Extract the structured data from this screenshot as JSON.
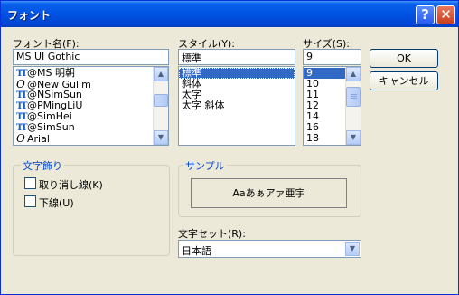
{
  "window": {
    "title": "フォント"
  },
  "font": {
    "label": "フォント名(F):",
    "value": "MS UI Gothic",
    "items": [
      {
        "glyph": "TT",
        "name": "@MS 明朝"
      },
      {
        "glyph": "O",
        "name": "@New Gulim"
      },
      {
        "glyph": "TT",
        "name": "@NSimSun"
      },
      {
        "glyph": "TT",
        "name": "@PMingLiU"
      },
      {
        "glyph": "TT",
        "name": "@SimHei"
      },
      {
        "glyph": "TT",
        "name": "@SimSun"
      },
      {
        "glyph": "O",
        "name": "Arial"
      }
    ]
  },
  "style": {
    "label": "スタイル(Y):",
    "value": "標準",
    "items": [
      "標準",
      "斜体",
      "太字",
      "太字 斜体"
    ],
    "selected": "標準"
  },
  "size": {
    "label": "サイズ(S):",
    "value": "9",
    "items": [
      "9",
      "10",
      "11",
      "12",
      "14",
      "16",
      "18"
    ],
    "selected": "9"
  },
  "buttons": {
    "ok": "OK",
    "cancel": "キャンセル"
  },
  "effects": {
    "title": "文字飾り",
    "strikeout": "取り消し線(K)",
    "underline": "下線(U)",
    "strikeout_checked": false,
    "underline_checked": false
  },
  "sample": {
    "title": "サンプル",
    "text": "Aaあぁアァ亜宇"
  },
  "charset": {
    "label": "文字セット(R):",
    "value": "日本語"
  }
}
